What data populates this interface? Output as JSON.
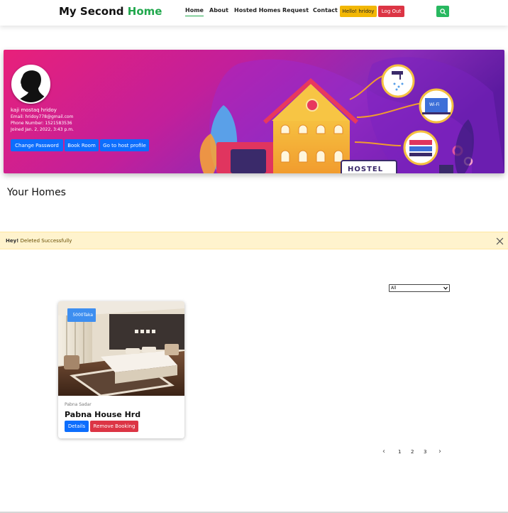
{
  "navbar": {
    "brand_prefix": "My Second",
    "brand_accent": "Home",
    "links": [
      "Home",
      "About",
      "Hosted Homes",
      "Request",
      "Contact"
    ],
    "active_link": "Home",
    "hello_label": "Hello! hridoy",
    "logout_label": "Log Out",
    "search_icon": "search-icon"
  },
  "profile": {
    "name": "kaji mostaq hridoy",
    "email": "Email: hridoy778@gmail.com",
    "phone": "Phone Number: 1521583536",
    "joined": "Joined Jan. 2, 2022, 3:43 p.m.",
    "buttons": {
      "change_password": "Change Password",
      "book_room": "Book Room",
      "host_profile": "Go to host profile"
    },
    "banner_sign": "HOSTEL",
    "wifi_label": "Wi-Fi"
  },
  "section_title": "Your Homes",
  "alert": {
    "strong": "Hey!",
    "message": "Deleted Successfully",
    "close_icon": "close-icon"
  },
  "filter": {
    "selected": "All"
  },
  "homes": [
    {
      "price": "5000Taka",
      "location": "Pabna Sadar",
      "title": "Pabna House Hrd",
      "details_label": "Details",
      "remove_label": "Remove Booking"
    }
  ],
  "pagination": {
    "prev": "‹",
    "pages": [
      "1",
      "2",
      "3"
    ],
    "next": "›"
  },
  "colors": {
    "brand_green": "#21a84d",
    "primary": "#0d6efd",
    "danger": "#dc3545",
    "warning": "#f2b705",
    "alert_bg": "#fff3cd",
    "banner_pink": "#e01e7a",
    "banner_purple": "#6a1b9a"
  }
}
